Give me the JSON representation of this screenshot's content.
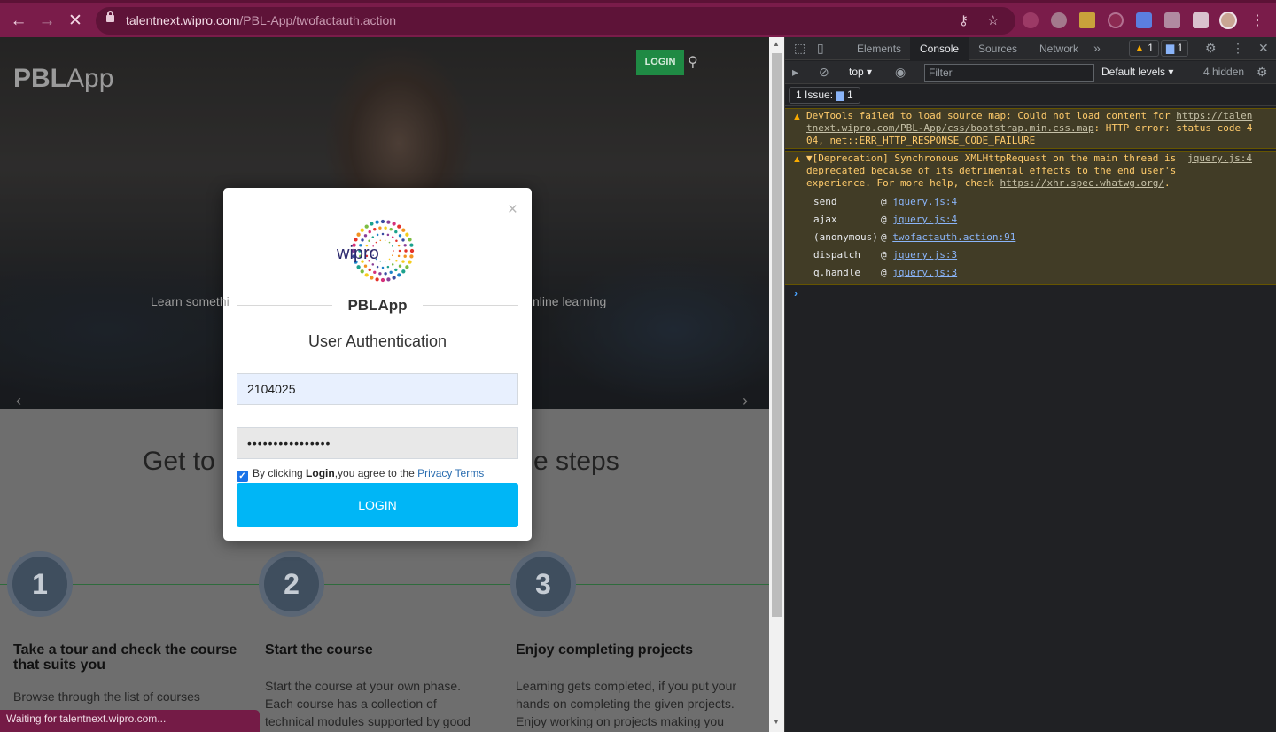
{
  "browser": {
    "url_host": "talentnext.wipro.com",
    "url_path": "/PBL-App/twofactauth.action",
    "status_text": "Waiting for talentnext.wipro.com..."
  },
  "page": {
    "logo_bold": "PBL",
    "logo_light": "App",
    "login_top": "LOGIN",
    "hero_text_left": "Learn somethi",
    "hero_text_right": "nline learning",
    "steps_title_left": "Get to",
    "steps_title_right": "e steps",
    "steps": [
      {
        "num": "1",
        "title": "Take a tour and check the course that suits you",
        "desc": "Browse through the list of courses available. Check the content of"
      },
      {
        "num": "2",
        "title": "Start the course",
        "desc": "Start the course at your own phase. Each course has a collection of technical modules supported by good amount of"
      },
      {
        "num": "3",
        "title": "Enjoy completing projects",
        "desc": "Learning gets completed, if you put your hands on completing the given projects. Enjoy working on projects making you"
      }
    ]
  },
  "modal": {
    "close": "×",
    "logo_text": "wipro",
    "brand": "PBLApp",
    "subtitle": "User Authentication",
    "username": "2104025",
    "password_mask": "••••••••••••••••",
    "agree_prefix": "By clicking ",
    "agree_bold": "Login",
    "agree_mid": ",you agree to the ",
    "agree_link": "Privacy Terms",
    "login_label": "LOGIN",
    "checkbox_checked": true
  },
  "devtools": {
    "tabs": [
      "Elements",
      "Console",
      "Sources",
      "Network"
    ],
    "active_tab": "Console",
    "more_tabs": "»",
    "warn_count": "1",
    "msg_count": "1",
    "context": "top",
    "filter_placeholder": "Filter",
    "levels": "Default levels",
    "hidden_count": "4 hidden",
    "issues_label": "1 Issue:",
    "issues_count": "1",
    "warnings": [
      {
        "text": "DevTools failed to load source map: Could not load content for ",
        "link": "https://talentnext.wipro.com/PBL-App/css/bootstrap.min.css.map",
        "tail": ": HTTP error: status code 404, net::ERR_HTTP_RESPONSE_CODE_FAILURE"
      },
      {
        "text": "▼[Deprecation] Synchronous XMLHttpRequest on the main thread is deprecated because of its detrimental effects to the end user's experience. For more help, check ",
        "link": "https://xhr.spec.whatwg.org/",
        "tail": ".",
        "source": "jquery.js:4"
      }
    ],
    "stack": [
      {
        "fn": "send",
        "src": "jquery.js:4"
      },
      {
        "fn": "ajax",
        "src": "jquery.js:4"
      },
      {
        "fn": "(anonymous)",
        "src": "twofactauth.action:91"
      },
      {
        "fn": "dispatch",
        "src": "jquery.js:3"
      },
      {
        "fn": "q.handle",
        "src": "jquery.js:3"
      }
    ],
    "prompt": "›"
  },
  "colors": {
    "chrome_bg": "#7a1c4a",
    "login_btn": "#00b6f6",
    "top_login": "#1f8a44",
    "warn_bg": "#413c26",
    "warn_text": "#ffcb6b"
  }
}
